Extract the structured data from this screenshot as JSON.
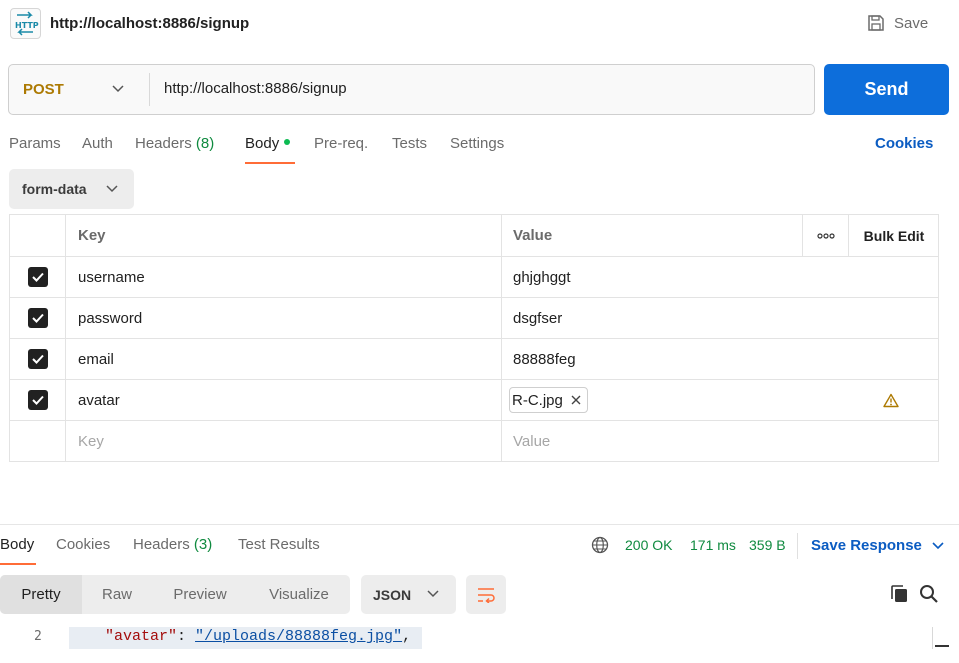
{
  "header": {
    "icon": "http-icon",
    "title": "http://localhost:8886/signup",
    "save_label": "Save"
  },
  "request": {
    "method": "POST",
    "url": "http://localhost:8886/signup",
    "send_label": "Send"
  },
  "req_tabs": {
    "params": "Params",
    "auth": "Auth",
    "headers": "Headers",
    "headers_count": "(8)",
    "body": "Body",
    "prereq": "Pre-req.",
    "tests": "Tests",
    "settings": "Settings",
    "cookies": "Cookies"
  },
  "body_type": "form-data",
  "table": {
    "key_header": "Key",
    "value_header": "Value",
    "more_label": "ooo",
    "bulk_edit": "Bulk Edit",
    "rows": [
      {
        "key": "username",
        "value": "ghjghggt",
        "checked": true
      },
      {
        "key": "password",
        "value": "dsgfser",
        "checked": true
      },
      {
        "key": "email",
        "value": "88888feg",
        "checked": true
      },
      {
        "key": "avatar",
        "value": "R-C.jpg",
        "checked": true,
        "type": "file",
        "warning": true
      }
    ],
    "key_placeholder": "Key",
    "value_placeholder": "Value"
  },
  "response": {
    "tabs": {
      "body": "Body",
      "cookies": "Cookies",
      "headers": "Headers",
      "headers_count": "(3)",
      "test_results": "Test Results"
    },
    "status": "200 OK",
    "time": "171 ms",
    "size": "359 B",
    "save_response": "Save Response",
    "views": {
      "pretty": "Pretty",
      "raw": "Raw",
      "preview": "Preview",
      "visualize": "Visualize"
    },
    "format": "JSON",
    "code": {
      "line_number": "2",
      "key": "\"avatar\"",
      "sep": ": ",
      "value": "\"/uploads/88888feg.jpg\"",
      "tail": ","
    }
  },
  "colors": {
    "accent": "#ff6c37",
    "send": "#0d6edb",
    "method_post": "#ad7a03",
    "status_green": "#0f8a3f",
    "link_blue": "#0b5cc2"
  }
}
